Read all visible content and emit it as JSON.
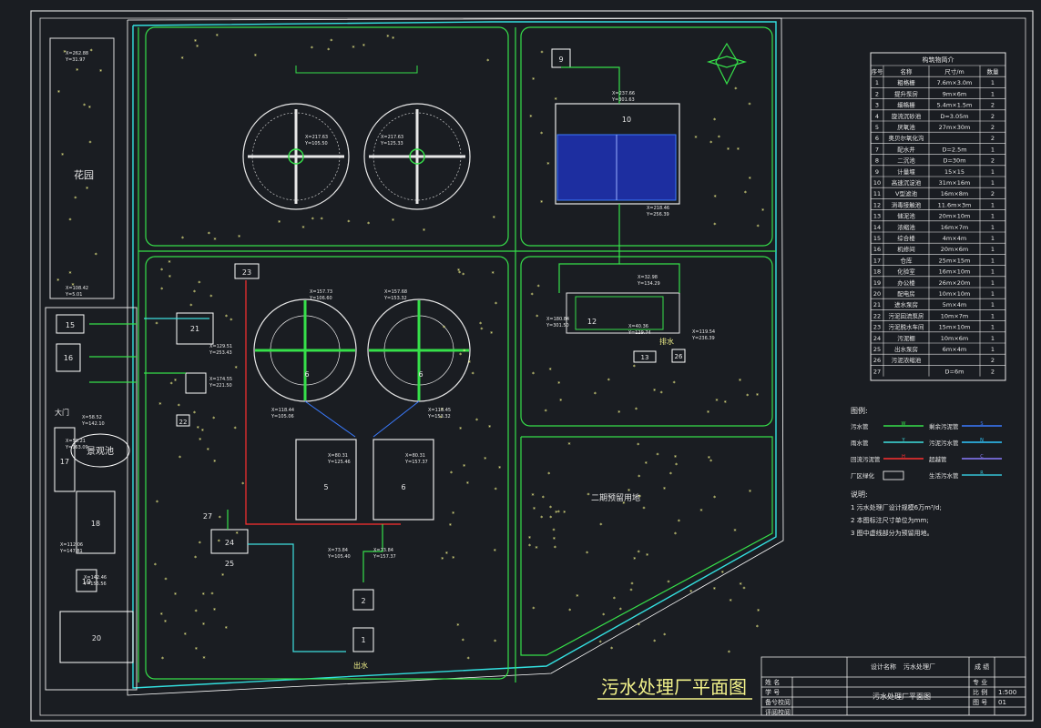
{
  "drawing": {
    "main_title": "污水处理厂平面图",
    "garden_label": "花园",
    "pond_label": "景观池",
    "gate_label": "大门",
    "reserved_area_label": "二期预留用地",
    "outlet_label": "出水",
    "outlet_label_2": "排水",
    "building_numbers": [
      "1",
      "2",
      "3",
      "4",
      "5",
      "6",
      "7",
      "8",
      "9",
      "10",
      "11",
      "12",
      "13",
      "14",
      "15",
      "16",
      "17",
      "18",
      "19",
      "20",
      "21",
      "22",
      "23",
      "24",
      "25",
      "26",
      "27"
    ]
  },
  "structure_table": {
    "title": "构筑物简介",
    "headers": [
      "序号",
      "名称",
      "尺寸/m",
      "数量"
    ],
    "rows": [
      [
        "1",
        "粗格栅",
        "7.6m×3.0m",
        "1"
      ],
      [
        "2",
        "提升泵房",
        "9m×6m",
        "1"
      ],
      [
        "3",
        "细格栅",
        "5.4m×1.5m",
        "2"
      ],
      [
        "4",
        "旋流沉砂池",
        "D=3.05m",
        "2"
      ],
      [
        "5",
        "厌氧池",
        "27m×30m",
        "2"
      ],
      [
        "6",
        "奥贝尔氧化沟",
        "",
        "2"
      ],
      [
        "7",
        "配水井",
        "D=2.5m",
        "1"
      ],
      [
        "8",
        "二沉池",
        "D=30m",
        "2"
      ],
      [
        "9",
        "计量堰",
        "15×15",
        "1"
      ],
      [
        "10",
        "高速沉淀池",
        "31m×16m",
        "1"
      ],
      [
        "11",
        "V型滤池",
        "16m×8m",
        "2"
      ],
      [
        "12",
        "消毒接触池",
        "11.6m×3m",
        "1"
      ],
      [
        "13",
        "储泥池",
        "20m×10m",
        "1"
      ],
      [
        "14",
        "浓缩池",
        "16m×7m",
        "1"
      ],
      [
        "15",
        "综合楼",
        "4m×4m",
        "1"
      ],
      [
        "16",
        "机修间",
        "20m×6m",
        "1"
      ],
      [
        "17",
        "仓库",
        "25m×15m",
        "1"
      ],
      [
        "18",
        "化验室",
        "16m×10m",
        "1"
      ],
      [
        "19",
        "办公楼",
        "26m×20m",
        "1"
      ],
      [
        "20",
        "配电房",
        "10m×10m",
        "1"
      ],
      [
        "21",
        "进水泵房",
        "5m×4m",
        "1"
      ],
      [
        "22",
        "污泥回流泵房",
        "10m×7m",
        "1"
      ],
      [
        "23",
        "污泥脱水车间",
        "15m×10m",
        "1"
      ],
      [
        "24",
        "污泥棚",
        "10m×6m",
        "1"
      ],
      [
        "25",
        "出水泵房",
        "6m×4m",
        "1"
      ],
      [
        "26",
        "污泥浓缩池",
        "",
        "2"
      ],
      [
        "27",
        "",
        "D=6m",
        "2"
      ]
    ]
  },
  "legend": {
    "title": "图例:",
    "items": [
      {
        "label": "污水管",
        "color": "#36e04a",
        "code": "W"
      },
      {
        "label": "剩余污泥管",
        "color": "#3a7bff",
        "code": "S"
      },
      {
        "label": "雨水管",
        "color": "#3ee0e0",
        "code": "Y"
      },
      {
        "label": "污泥污水管",
        "color": "#2fc8ff",
        "code": "N"
      },
      {
        "label": "回流污泥管",
        "color": "#ff3030",
        "code": "H"
      },
      {
        "label": "超越管",
        "color": "#8a7cff",
        "code": "C"
      },
      {
        "label": "厂区绿化",
        "color": "#ffffff",
        "code": ""
      },
      {
        "label": "生活污水管",
        "color": "#34c4d8",
        "code": "R"
      }
    ]
  },
  "notes": {
    "title": "说明:",
    "items": [
      "1 污水处理厂设计规模6万m³/d;",
      "2 本图标注尺寸单位为mm;",
      "3 图中虚线部分为预留用地。"
    ]
  },
  "title_block": {
    "design_name_label": "设计名称",
    "design_name_value": "污水处理厂",
    "score_label": "成 绩",
    "name_label": "姓 名",
    "student_id_label": "学 号",
    "date_label": "备兮校阅",
    "reviewer_label": "评阅校阅",
    "drawing_name": "污水处理厂平面图",
    "major_label": "专 业",
    "scale_label": "比 例",
    "scale_value": "1:500",
    "sheet_label": "图 号",
    "sheet_value": "01"
  },
  "coordinates": [
    "X=262.88 Y=31.97",
    "X=108.42 Y=5.01",
    "X=217.63 Y=105.50",
    "X=217.63 Y=125.33",
    "X=237.66 Y=301.63",
    "X=218.46 Y=256.39",
    "X=157.73 Y=106.60",
    "X=157.68 Y=153.32",
    "X=118.44 Y=105.06",
    "X=118.45 Y=153.32",
    "X=80.31 Y=125.46",
    "X=80.31 Y=157.37",
    "X=73.84 Y=105.40",
    "X=73.84 Y=157.37",
    "X=58.52 Y=142.10",
    "X=58.21 Y=163.09",
    "X=40.36 Y=129.74",
    "X=32.98 Y=134.29",
    "X=180.84 Y=301.50",
    "X=119.54 Y=236.39",
    "X=129.51 Y=253.43",
    "X=174.55 Y=221.50",
    "X=112.06 Y=147.81",
    "X=142.46 Y=156.56"
  ]
}
